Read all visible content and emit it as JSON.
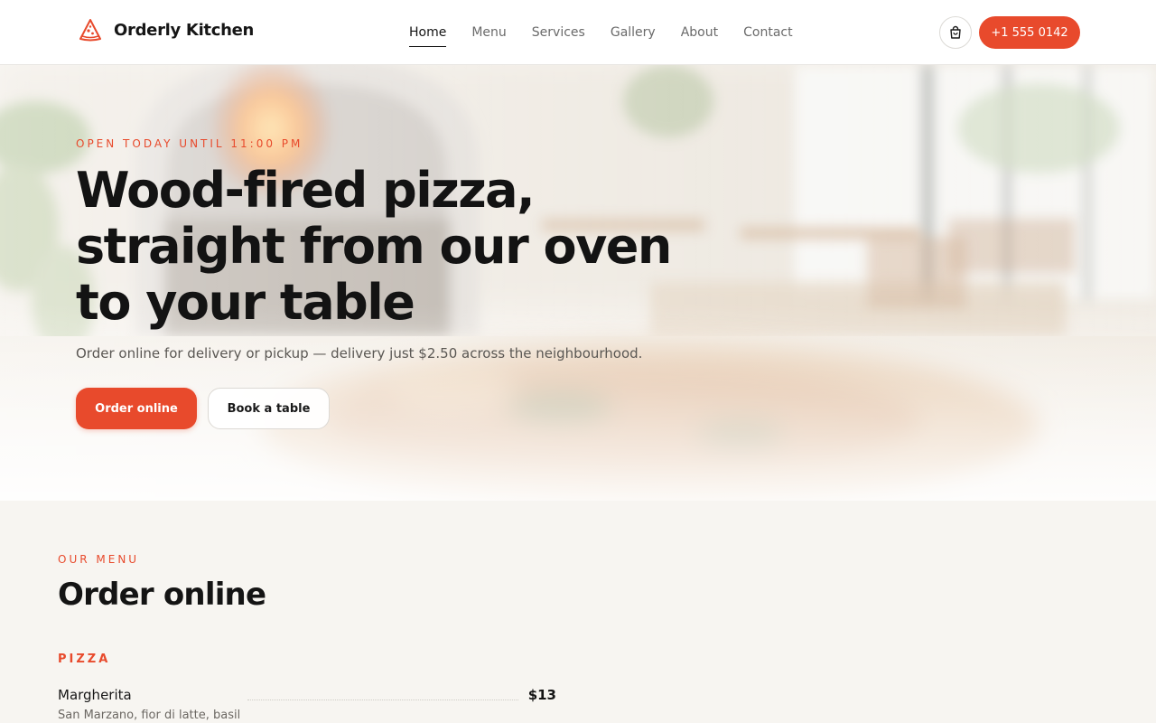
{
  "brand": {
    "name": "Orderly Kitchen",
    "logo_icon": "pizza-slice-icon",
    "accent_color": "#e84a2c"
  },
  "nav": {
    "items": [
      {
        "label": "Home",
        "active": true
      },
      {
        "label": "Menu",
        "active": false
      },
      {
        "label": "Services",
        "active": false
      },
      {
        "label": "Gallery",
        "active": false
      },
      {
        "label": "About",
        "active": false
      },
      {
        "label": "Contact",
        "active": false
      }
    ],
    "cart_icon": "shopping-bag-icon",
    "phone_label": "+1 555 0142"
  },
  "hero": {
    "eyebrow": "OPEN TODAY UNTIL 11:00 PM",
    "title": "Wood-fired pizza, straight from our oven to your table",
    "subtitle": "Order online for delivery or pickup — delivery just $2.50 across the neighbourhood.",
    "primary_button": "Order online",
    "secondary_button": "Book a table",
    "background": "blurred-restaurant-interior-with-pizza-oven"
  },
  "menu": {
    "eyebrow": "OUR MENU",
    "title": "Order online",
    "category": "PIZZA",
    "items": [
      {
        "name": "Margherita",
        "description": "San Marzano, fior di latte, basil",
        "price": "$13"
      }
    ]
  }
}
